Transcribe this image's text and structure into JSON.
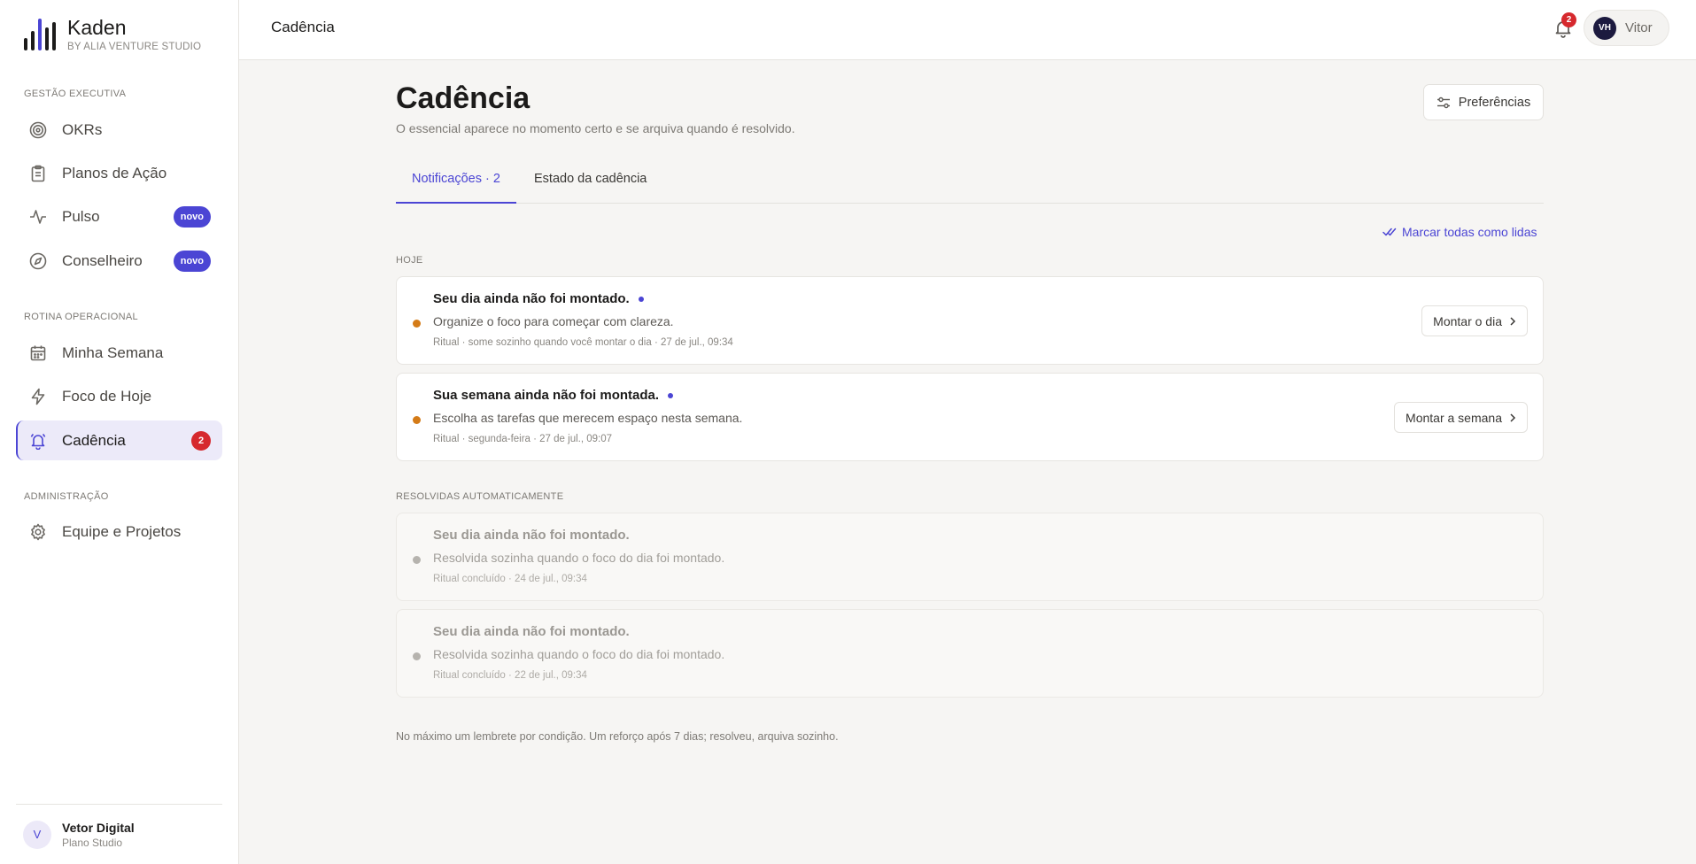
{
  "brand": {
    "name": "Kaden",
    "subtitle": "BY ALIA VENTURE STUDIO"
  },
  "sidebar": {
    "sections": [
      {
        "label": "GESTÃO EXECUTIVA"
      },
      {
        "label": "ROTINA OPERACIONAL"
      },
      {
        "label": "ADMINISTRAÇÃO"
      }
    ],
    "items": [
      {
        "label": "OKRs",
        "icon": "target-icon"
      },
      {
        "label": "Planos de Ação",
        "icon": "clipboard-icon"
      },
      {
        "label": "Pulso",
        "icon": "activity-icon",
        "badge": "novo"
      },
      {
        "label": "Conselheiro",
        "icon": "compass-icon",
        "badge": "novo"
      },
      {
        "label": "Minha Semana",
        "icon": "calendar-icon"
      },
      {
        "label": "Foco de Hoje",
        "icon": "lightning-icon"
      },
      {
        "label": "Cadência",
        "icon": "bell-icon",
        "badge": "2",
        "active": true
      },
      {
        "label": "Equipe e Projetos",
        "icon": "gear-icon"
      }
    ],
    "footer": {
      "avatar": "V",
      "name": "Vetor Digital",
      "subtitle": "Plano Studio"
    }
  },
  "topbar": {
    "title": "Cadência",
    "notifications_count": "2",
    "user": {
      "initials": "VH",
      "name": "Vitor"
    }
  },
  "main": {
    "title": "Cadência",
    "subtitle": "O essencial aparece no momento certo e se arquiva quando é resolvido.",
    "preferences_label": "Preferências",
    "tabs": [
      {
        "label": "Notificações · 2",
        "active": true
      },
      {
        "label": "Estado da cadência",
        "active": false
      }
    ],
    "mark_all_label": "Marcar todas como lidas",
    "groups": {
      "today": {
        "label": "HOJE",
        "cards": [
          {
            "title": "Seu dia ainda não foi montado.",
            "description": "Organize o foco para começar com clareza.",
            "meta": "Ritual · some sozinho quando você montar o dia · 27 de jul., 09:34",
            "action": "Montar o dia"
          },
          {
            "title": "Sua semana ainda não foi montada.",
            "description": "Escolha as tarefas que merecem espaço nesta semana.",
            "meta": "Ritual · segunda-feira · 27 de jul., 09:07",
            "action": "Montar a semana"
          }
        ]
      },
      "resolved": {
        "label": "RESOLVIDAS AUTOMATICAMENTE",
        "cards": [
          {
            "title": "Seu dia ainda não foi montado.",
            "description": "Resolvida sozinha quando o foco do dia foi montado.",
            "meta": "Ritual concluído · 24 de jul., 09:34"
          },
          {
            "title": "Seu dia ainda não foi montado.",
            "description": "Resolvida sozinha quando o foco do dia foi montado.",
            "meta": "Ritual concluído · 22 de jul., 09:34"
          }
        ]
      }
    },
    "footnote": "No máximo um lembrete por condição. Um reforço após 7 dias; resolveu, arquiva sozinho."
  },
  "colors": {
    "accent": "#4b45d4",
    "danger": "#d6292e",
    "pending_dot": "#d47b17"
  }
}
